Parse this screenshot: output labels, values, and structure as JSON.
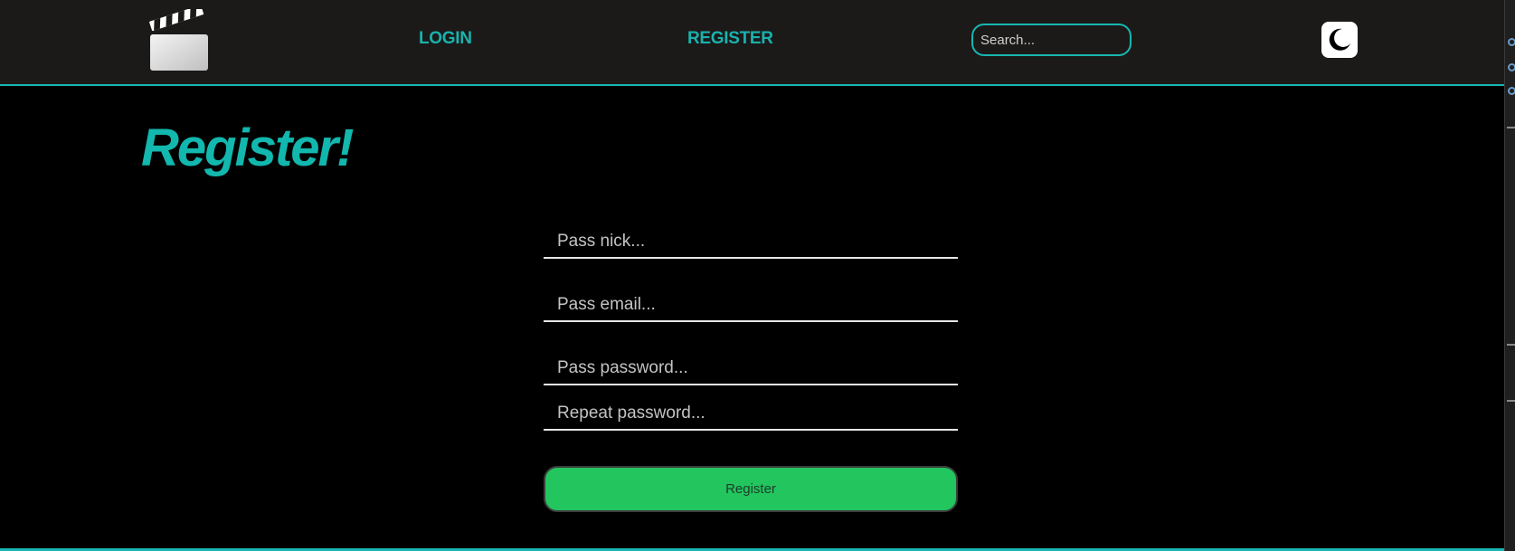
{
  "nav": {
    "login_label": "LOGIN",
    "register_label": "REGISTER",
    "search_placeholder": "Search..."
  },
  "page": {
    "title": "Register!"
  },
  "form": {
    "nick_placeholder": "Pass nick...",
    "email_placeholder": "Pass email...",
    "password_placeholder": "Pass password...",
    "repeat_placeholder": "Repeat password...",
    "submit_label": "Register"
  },
  "colors": {
    "accent": "#1ab2ad",
    "navbar_bg": "#1b1a19",
    "page_bg": "#000000",
    "button_bg": "#22c55e"
  },
  "icons": {
    "logo": "clapperboard-icon",
    "theme": "moon-icon"
  }
}
